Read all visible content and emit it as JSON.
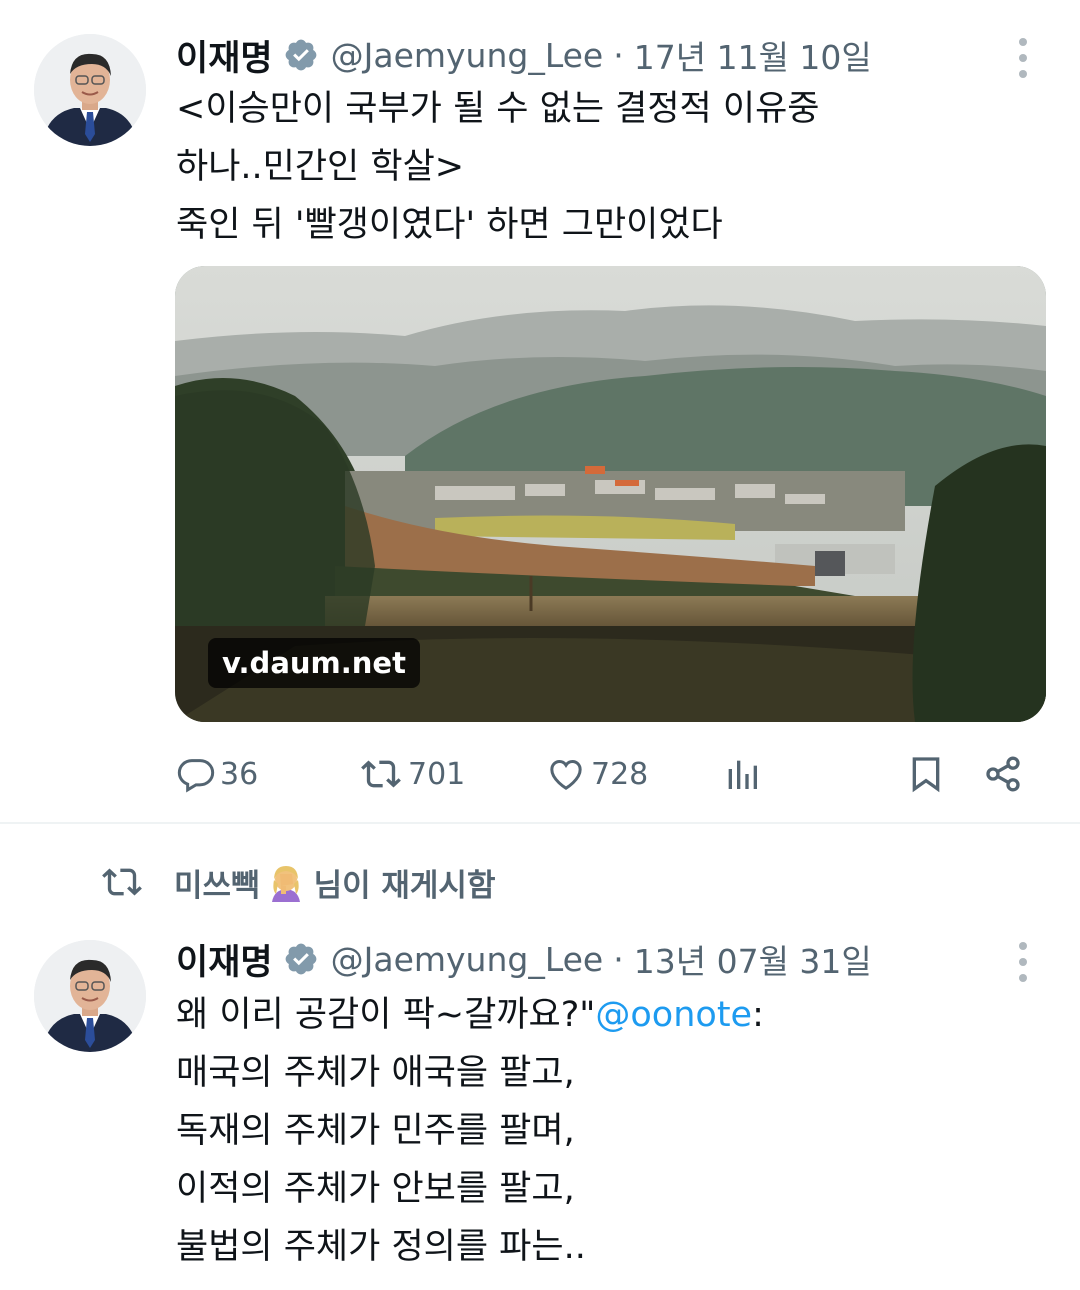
{
  "tweet1": {
    "author_name": "이재명",
    "handle": "@Jaemyung_Lee",
    "separator": "·",
    "date": "17년 11월 10일",
    "lines": [
      "<이승만이 국부가 될 수 없는 결정적 이유중",
      "하나..민간인 학살>",
      "죽인 뒤 '빨갱이였다' 하면 그만이었다"
    ],
    "media_domain": "v.daum.net",
    "actions": {
      "replies": "36",
      "retweets": "701",
      "likes": "728"
    }
  },
  "retweet_banner": {
    "user": "미쓰빽",
    "suffix": "님이 재게시함"
  },
  "tweet2": {
    "author_name": "이재명",
    "handle": "@Jaemyung_Lee",
    "separator": "·",
    "date": "13년 07월 31일",
    "first_line_text": "왜 이리 공감이 팍~갈까요?\"",
    "mention": "@oonote",
    "first_line_tail": ":",
    "lines": [
      "매국의 주체가 애국을 팔고,",
      "독재의 주체가 민주를 팔며,",
      "이적의 주체가 안보를 팔고,",
      "불법의 주체가 정의를 파는.."
    ]
  },
  "icons": {
    "verified": "verified-badge-icon",
    "more": "more-options-icon",
    "reply": "reply-icon",
    "retweet": "retweet-icon",
    "like": "heart-icon",
    "views": "views-icon",
    "bookmark": "bookmark-icon",
    "share": "share-icon"
  },
  "colors": {
    "text": "#0f1419",
    "secondary": "#536471",
    "link": "#1d9bf0",
    "divider": "#eff3f4"
  }
}
